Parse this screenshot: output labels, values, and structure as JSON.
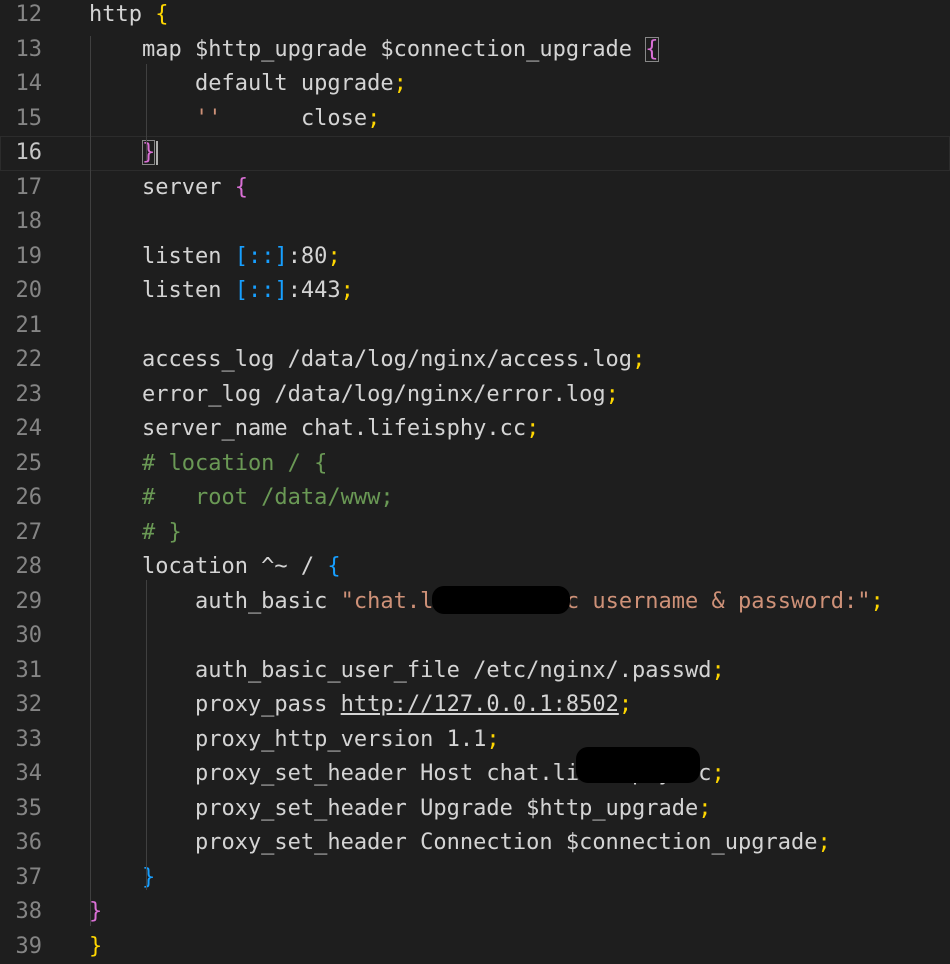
{
  "editor": {
    "current_line": 16,
    "lines": [
      {
        "n": "12",
        "tokens": [
          {
            "t": "http ",
            "c": "p"
          },
          {
            "t": "{",
            "c": "b1"
          }
        ]
      },
      {
        "n": "13",
        "tokens": [
          {
            "t": "    map $http_upgrade $connection_upgrade ",
            "c": "p"
          },
          {
            "t": "{",
            "c": "b2",
            "match": true
          }
        ]
      },
      {
        "n": "14",
        "tokens": [
          {
            "t": "        default upgrade",
            "c": "p"
          },
          {
            "t": ";",
            "c": "b1"
          }
        ]
      },
      {
        "n": "15",
        "tokens": [
          {
            "t": "        ",
            "c": "p"
          },
          {
            "t": "''",
            "c": "st"
          },
          {
            "t": "      close",
            "c": "p"
          },
          {
            "t": ";",
            "c": "b1"
          }
        ]
      },
      {
        "n": "16",
        "tokens": [
          {
            "t": "    ",
            "c": "p"
          },
          {
            "t": "}",
            "c": "b2",
            "match": true,
            "cursor": true
          }
        ]
      },
      {
        "n": "17",
        "tokens": [
          {
            "t": "    server ",
            "c": "p"
          },
          {
            "t": "{",
            "c": "b2"
          }
        ]
      },
      {
        "n": "18",
        "tokens": []
      },
      {
        "n": "19",
        "tokens": [
          {
            "t": "    listen ",
            "c": "p"
          },
          {
            "t": "[::]",
            "c": "b3"
          },
          {
            "t": ":80",
            "c": "p"
          },
          {
            "t": ";",
            "c": "b1"
          }
        ]
      },
      {
        "n": "20",
        "tokens": [
          {
            "t": "    listen ",
            "c": "p"
          },
          {
            "t": "[::]",
            "c": "b3"
          },
          {
            "t": ":443",
            "c": "p"
          },
          {
            "t": ";",
            "c": "b1"
          }
        ]
      },
      {
        "n": "21",
        "tokens": []
      },
      {
        "n": "22",
        "tokens": [
          {
            "t": "    access_log /data/log/nginx/access.log",
            "c": "p"
          },
          {
            "t": ";",
            "c": "b1"
          }
        ]
      },
      {
        "n": "23",
        "tokens": [
          {
            "t": "    error_log /data/log/nginx/error.log",
            "c": "p"
          },
          {
            "t": ";",
            "c": "b1"
          }
        ]
      },
      {
        "n": "24",
        "tokens": [
          {
            "t": "    server_name chat.lifeisphy.cc",
            "c": "p"
          },
          {
            "t": ";",
            "c": "b1"
          }
        ]
      },
      {
        "n": "25",
        "tokens": [
          {
            "t": "    # location / {",
            "c": "cm"
          }
        ]
      },
      {
        "n": "26",
        "tokens": [
          {
            "t": "    #   root /data/www;",
            "c": "cm"
          }
        ]
      },
      {
        "n": "27",
        "tokens": [
          {
            "t": "    # }",
            "c": "cm"
          }
        ]
      },
      {
        "n": "28",
        "tokens": [
          {
            "t": "    location ^~ / ",
            "c": "p"
          },
          {
            "t": "{",
            "c": "b3"
          }
        ]
      },
      {
        "n": "29",
        "tokens": [
          {
            "t": "        auth_basic ",
            "c": "p"
          },
          {
            "t": "\"chat.lifeisphy.cc username & password:\"",
            "c": "st"
          },
          {
            "t": ";",
            "c": "b1"
          }
        ]
      },
      {
        "n": "30",
        "tokens": []
      },
      {
        "n": "31",
        "tokens": [
          {
            "t": "        auth_basic_user_file /etc/nginx/.passwd",
            "c": "p"
          },
          {
            "t": ";",
            "c": "b1"
          }
        ]
      },
      {
        "n": "32",
        "tokens": [
          {
            "t": "        proxy_pass ",
            "c": "p"
          },
          {
            "t": "http://127.0.0.1:8502",
            "c": "p",
            "url": true
          },
          {
            "t": ";",
            "c": "b1"
          }
        ]
      },
      {
        "n": "33",
        "tokens": [
          {
            "t": "        proxy_http_version 1.1",
            "c": "p"
          },
          {
            "t": ";",
            "c": "b1"
          }
        ]
      },
      {
        "n": "34",
        "tokens": [
          {
            "t": "        proxy_set_header Host chat.lifeisphy.cc",
            "c": "p"
          },
          {
            "t": ";",
            "c": "b1"
          }
        ]
      },
      {
        "n": "35",
        "tokens": [
          {
            "t": "        proxy_set_header Upgrade $http_upgrade",
            "c": "p"
          },
          {
            "t": ";",
            "c": "b1"
          }
        ]
      },
      {
        "n": "36",
        "tokens": [
          {
            "t": "        proxy_set_header Connection $connection_upgrade",
            "c": "p"
          },
          {
            "t": ";",
            "c": "b1"
          }
        ]
      },
      {
        "n": "37",
        "tokens": [
          {
            "t": "    ",
            "c": "p"
          },
          {
            "t": "}",
            "c": "b3"
          }
        ]
      },
      {
        "n": "38",
        "tokens": [
          {
            "t": "}",
            "c": "b2"
          }
        ]
      },
      {
        "n": "39",
        "tokens": [
          {
            "t": "}",
            "c": "b1"
          }
        ]
      }
    ]
  }
}
